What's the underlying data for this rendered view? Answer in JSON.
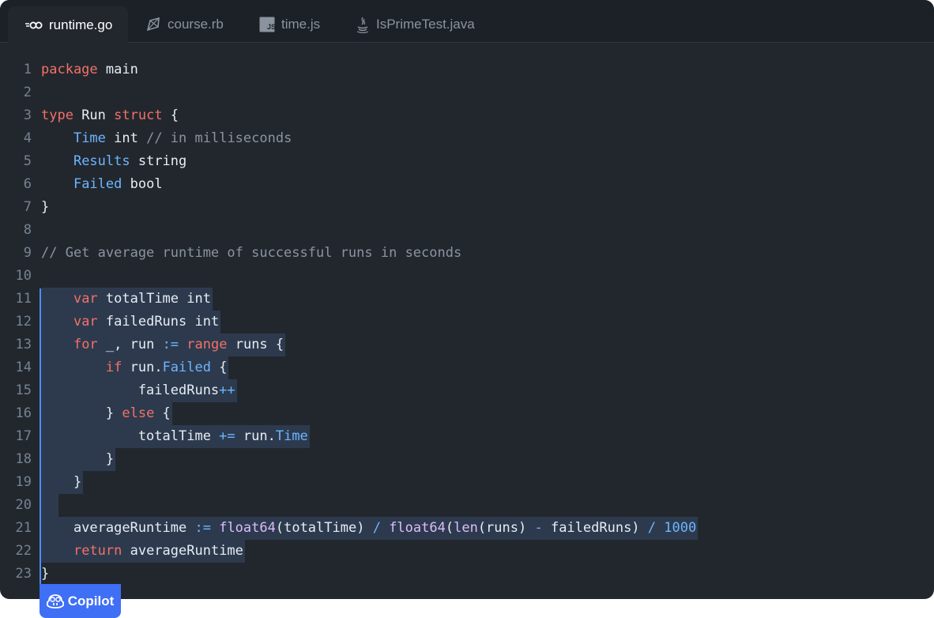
{
  "tabs": [
    {
      "label": "runtime.go",
      "icon": "go-icon",
      "active": true
    },
    {
      "label": "course.rb",
      "icon": "ruby-icon",
      "active": false
    },
    {
      "label": "time.js",
      "icon": "js-icon",
      "active": false,
      "icon_text": "JS"
    },
    {
      "label": "IsPrimeTest.java",
      "icon": "java-icon",
      "active": false
    }
  ],
  "editor": {
    "line_numbers": [
      "1",
      "2",
      "3",
      "4",
      "5",
      "6",
      "7",
      "8",
      "9",
      "10",
      "11",
      "12",
      "13",
      "14",
      "15",
      "16",
      "17",
      "18",
      "19",
      "20",
      "21",
      "22",
      "23"
    ],
    "lines": [
      [
        {
          "t": "package",
          "c": "kw"
        },
        {
          "t": " main",
          "c": "plain"
        }
      ],
      [],
      [
        {
          "t": "type",
          "c": "kw"
        },
        {
          "t": " Run ",
          "c": "plain"
        },
        {
          "t": "struct",
          "c": "kw"
        },
        {
          "t": " {",
          "c": "plain"
        }
      ],
      [
        {
          "t": "    ",
          "c": "plain"
        },
        {
          "t": "Time",
          "c": "fld"
        },
        {
          "t": " int ",
          "c": "plain"
        },
        {
          "t": "// in milliseconds",
          "c": "cm"
        }
      ],
      [
        {
          "t": "    ",
          "c": "plain"
        },
        {
          "t": "Results",
          "c": "fld"
        },
        {
          "t": " string",
          "c": "plain"
        }
      ],
      [
        {
          "t": "    ",
          "c": "plain"
        },
        {
          "t": "Failed",
          "c": "fld"
        },
        {
          "t": " bool",
          "c": "plain"
        }
      ],
      [
        {
          "t": "}",
          "c": "plain"
        }
      ],
      [],
      [
        {
          "t": "// Get average runtime of successful runs in seconds",
          "c": "cm"
        }
      ],
      [],
      [
        {
          "t": "    ",
          "c": "plain"
        },
        {
          "t": "var",
          "c": "kw"
        },
        {
          "t": " totalTime int",
          "c": "plain"
        }
      ],
      [
        {
          "t": "    ",
          "c": "plain"
        },
        {
          "t": "var",
          "c": "kw"
        },
        {
          "t": " failedRuns int",
          "c": "plain"
        }
      ],
      [
        {
          "t": "    ",
          "c": "plain"
        },
        {
          "t": "for",
          "c": "kw"
        },
        {
          "t": " _, run ",
          "c": "plain"
        },
        {
          "t": ":=",
          "c": "op"
        },
        {
          "t": " ",
          "c": "plain"
        },
        {
          "t": "range",
          "c": "kw"
        },
        {
          "t": " runs {",
          "c": "plain"
        }
      ],
      [
        {
          "t": "        ",
          "c": "plain"
        },
        {
          "t": "if",
          "c": "kw"
        },
        {
          "t": " run.",
          "c": "plain"
        },
        {
          "t": "Failed",
          "c": "fld"
        },
        {
          "t": " {",
          "c": "plain"
        }
      ],
      [
        {
          "t": "            failedRuns",
          "c": "plain"
        },
        {
          "t": "++",
          "c": "op"
        }
      ],
      [
        {
          "t": "        } ",
          "c": "plain"
        },
        {
          "t": "else",
          "c": "kw"
        },
        {
          "t": " {",
          "c": "plain"
        }
      ],
      [
        {
          "t": "            totalTime ",
          "c": "plain"
        },
        {
          "t": "+=",
          "c": "op"
        },
        {
          "t": " run.",
          "c": "plain"
        },
        {
          "t": "Time",
          "c": "fld"
        }
      ],
      [
        {
          "t": "        }",
          "c": "plain"
        }
      ],
      [
        {
          "t": "    }",
          "c": "plain"
        }
      ],
      [
        {
          "t": "  ",
          "c": "plain"
        }
      ],
      [
        {
          "t": "    averageRuntime ",
          "c": "plain"
        },
        {
          "t": ":=",
          "c": "op"
        },
        {
          "t": " ",
          "c": "plain"
        },
        {
          "t": "float64",
          "c": "fn"
        },
        {
          "t": "(totalTime) ",
          "c": "plain"
        },
        {
          "t": "/",
          "c": "op"
        },
        {
          "t": " ",
          "c": "plain"
        },
        {
          "t": "float64",
          "c": "fn"
        },
        {
          "t": "(",
          "c": "plain"
        },
        {
          "t": "len",
          "c": "fn"
        },
        {
          "t": "(runs) ",
          "c": "plain"
        },
        {
          "t": "-",
          "c": "op"
        },
        {
          "t": " failedRuns) ",
          "c": "plain"
        },
        {
          "t": "/",
          "c": "op"
        },
        {
          "t": " ",
          "c": "plain"
        },
        {
          "t": "1000",
          "c": "num"
        }
      ],
      [
        {
          "t": "    ",
          "c": "plain"
        },
        {
          "t": "return",
          "c": "kw"
        },
        {
          "t": " averageRuntime",
          "c": "plain"
        }
      ],
      [
        {
          "t": "}",
          "c": "plain"
        }
      ]
    ],
    "suggestion_lines": [
      "11",
      "12",
      "13",
      "14",
      "15",
      "16",
      "17",
      "18",
      "19",
      "20",
      "21",
      "22"
    ]
  },
  "copilot": {
    "label": "Copilot",
    "icon": "copilot-icon"
  },
  "colors": {
    "background": "#22272e",
    "tabbar": "#1c2128",
    "keyword": "#f47067",
    "field": "#6cb6ff",
    "comment": "#8b949e",
    "function": "#dcbdfb",
    "suggestion_bg": "#2d3a4e",
    "copilot_accent": "#3f6ff5"
  }
}
